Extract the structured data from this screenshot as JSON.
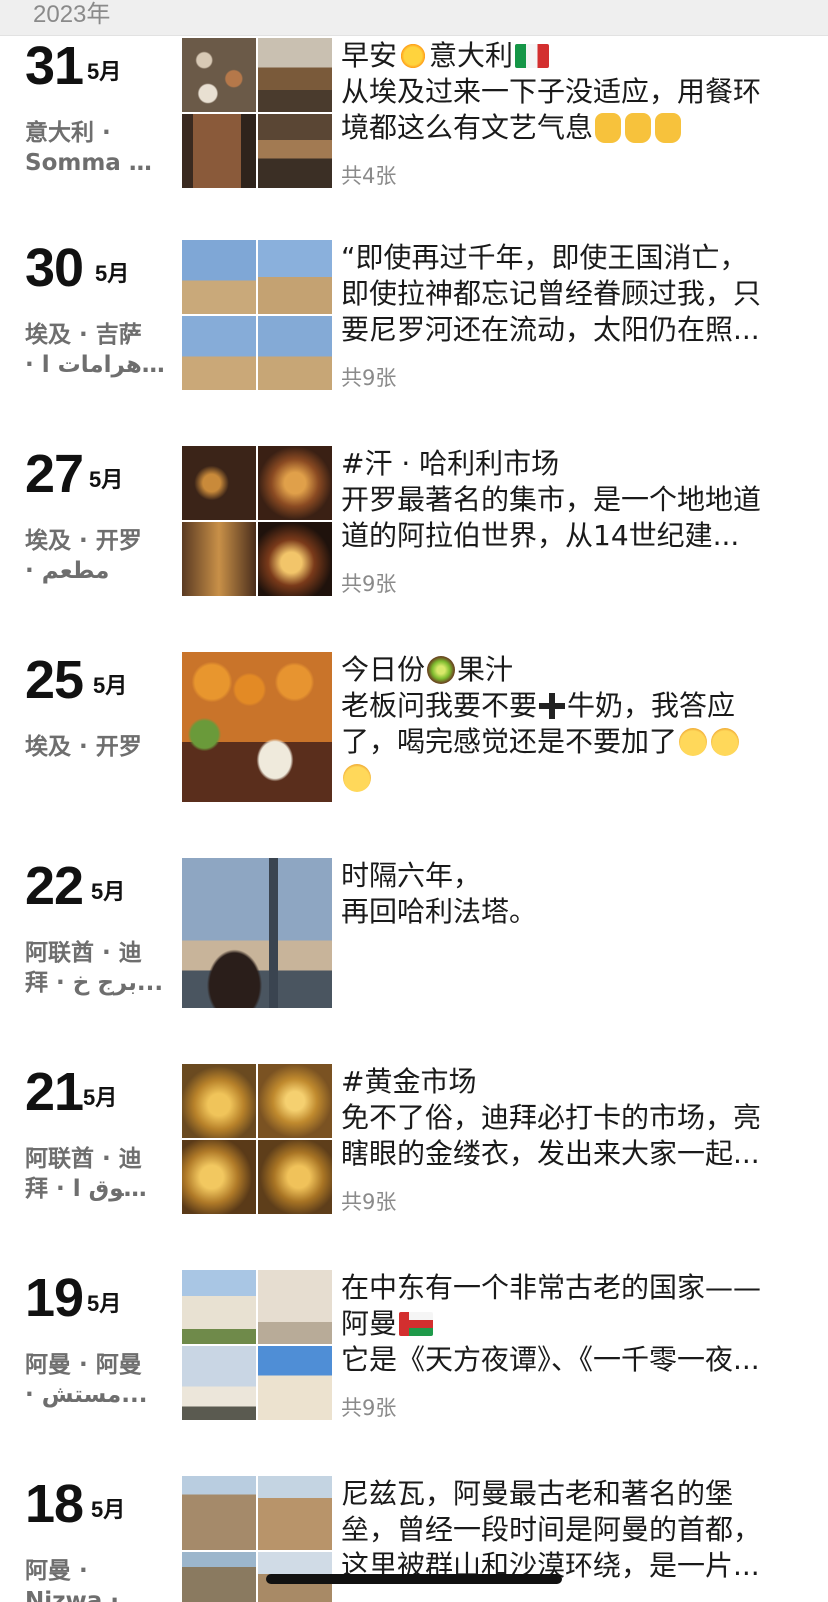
{
  "year": "2023年",
  "month_label": "5月",
  "entries": [
    {
      "day": "31",
      "location": [
        "意大利 ·",
        "Somma L..."
      ],
      "lines": [
        "早安",
        "意大利",
        "从埃及过来一下子没适应，用餐环",
        "境都这么有文艺气息"
      ],
      "count": "共4张"
    },
    {
      "day": "30",
      "location": [
        "埃及 · 吉萨",
        "· أهرامات ا..."
      ],
      "lines": [
        "“即使再过千年，即使王国消亡，",
        "即使拉神都忘记曾经眷顾过我，只",
        "要尼罗河还在流动，太阳仍在照..."
      ],
      "count": "共9张"
    },
    {
      "day": "27",
      "location": [
        "埃及 · 开罗",
        "· مطعم"
      ],
      "lines": [
        "#汗 · 哈利利市场",
        "开罗最著名的集市，是一个地地道",
        "道的阿拉伯世界，从14世纪建..."
      ],
      "count": "共9张"
    },
    {
      "day": "25",
      "location": [
        "埃及 · 开罗"
      ],
      "lines": [
        "今日份",
        "果汁",
        "老板问我要不要",
        "牛奶，我答应",
        "了，喝完感觉还是不要加了"
      ],
      "count": ""
    },
    {
      "day": "22",
      "location": [
        "阿联酋 · 迪",
        "拜 · برج خ..."
      ],
      "lines": [
        "时隔六年，",
        "再回哈利法塔。"
      ],
      "count": ""
    },
    {
      "day": "21",
      "location": [
        "阿联酋 · 迪",
        "拜 · سوق ا..."
      ],
      "lines": [
        "#黄金市场",
        "免不了俗，迪拜必打卡的市场，亮",
        "瞎眼的金缕衣，发出来大家一起..."
      ],
      "count": "共9张"
    },
    {
      "day": "19",
      "location": [
        "阿曼 · 阿曼",
        "· مستش..."
      ],
      "lines": [
        "在中东有一个非常古老的国家——",
        "阿曼",
        "它是《天方夜谭》、《一千零一夜..."
      ],
      "count": "共9张"
    },
    {
      "day": "18",
      "location": [
        "阿曼 ·",
        "Nizwa · ق..."
      ],
      "lines": [
        "尼兹瓦，阿曼最古老和著名的堡",
        "垒，曾经一段时间是阿曼的首都，",
        "这里被群山和沙漠环绕，是一片..."
      ],
      "count": ""
    }
  ]
}
